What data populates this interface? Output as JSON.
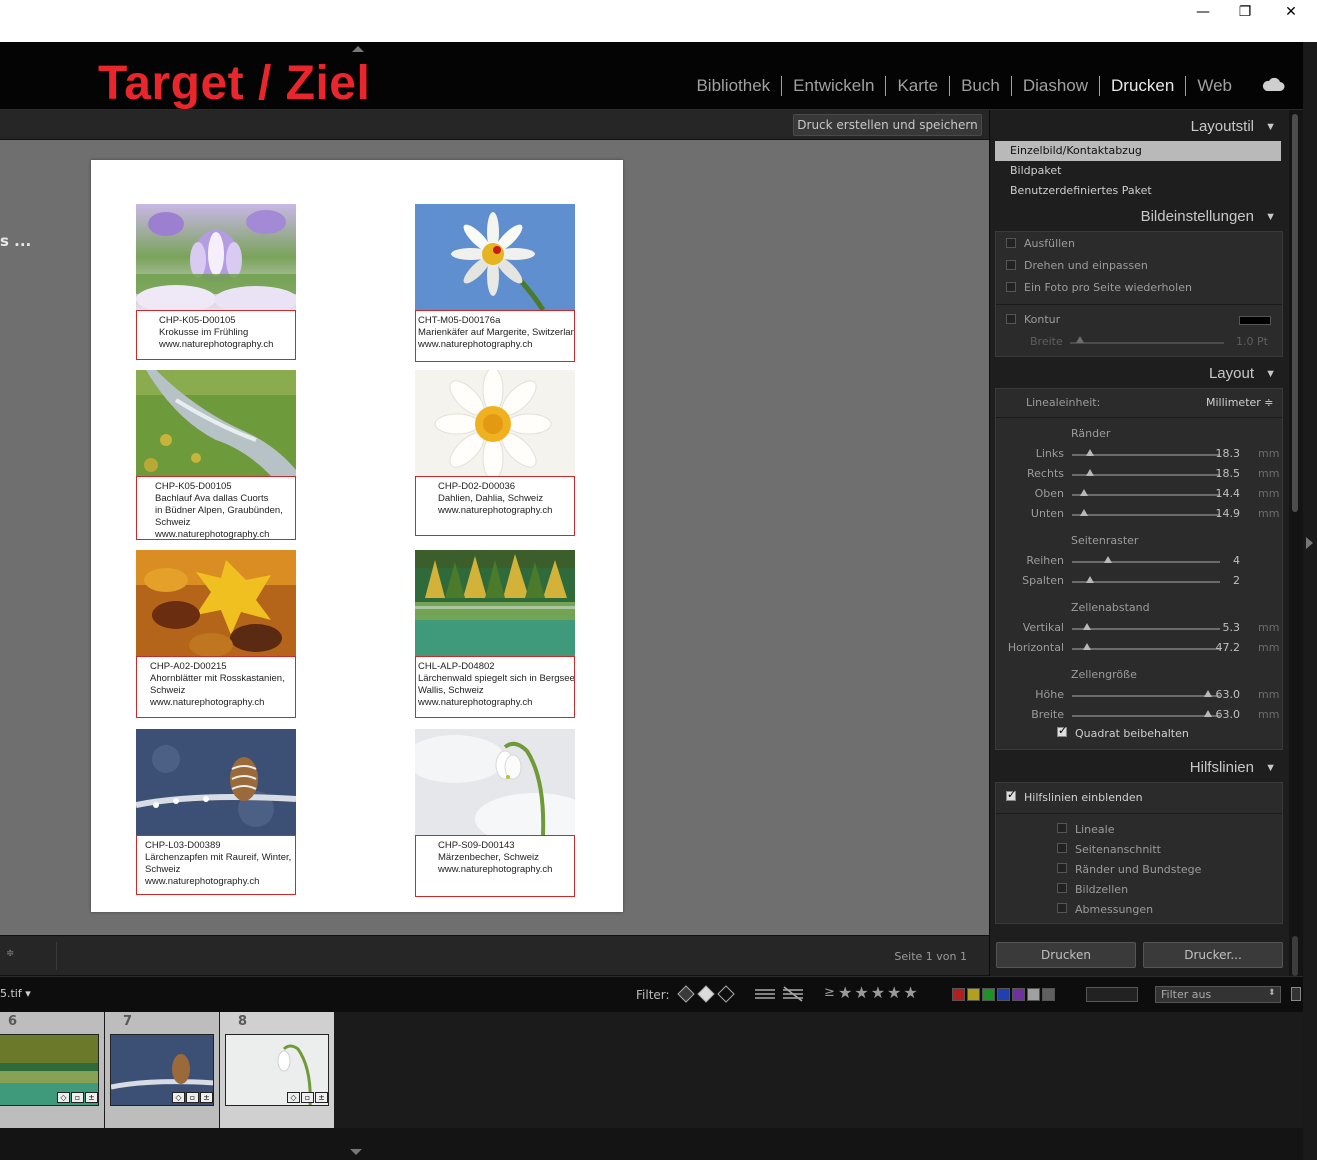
{
  "window": {
    "minimize": "—",
    "maximize": "❐",
    "close": "✕"
  },
  "header": {
    "brand": "Target / Ziel",
    "modules": [
      "Bibliothek",
      "Entwickeln",
      "Karte",
      "Buch",
      "Diashow",
      "Drucken",
      "Web"
    ],
    "active_module": "Drucken"
  },
  "toolbar": {
    "print_save": "Druck erstellen und speichern"
  },
  "workspace": {
    "left_fragment": "s ...",
    "page_status": "Seite 1 von 1",
    "cells": [
      {
        "lines": [
          "CHP-K05-D00105",
          "Krokusse im Frühling",
          "www.naturephotography.ch"
        ]
      },
      {
        "lines": [
          "CHT-M05-D00176a",
          "Marienkäfer auf Margerite, Switzerland",
          "www.naturephotography.ch"
        ]
      },
      {
        "lines": [
          "CHP-K05-D00105",
          "Bachlauf Ava dallas Cuorts",
          "in Büdner Alpen, Graubünden,",
          "Schweiz",
          "www.naturephotography.ch"
        ]
      },
      {
        "lines": [
          "CHP-D02-D00036",
          "Dahlien, Dahlia, Schweiz",
          "www.naturephotography.ch"
        ]
      },
      {
        "lines": [
          "CHP-A02-D00215",
          "Ahornblätter mit Rosskastanien,",
          "Schweiz",
          "www.naturephotography.ch"
        ]
      },
      {
        "lines": [
          "CHL-ALP-D04802",
          "Lärchenwald spiegelt sich in Bergsee,",
          "Wallis, Schweiz",
          "www.naturephotography.ch"
        ]
      },
      {
        "lines": [
          "CHP-L03-D00389",
          "Lärchenzapfen mit Raureif, Winter,",
          "Schweiz",
          "www.naturephotography.ch"
        ]
      },
      {
        "lines": [
          "CHP-S09-D00143",
          "Märzenbecher, Schweiz",
          "www.naturephotography.ch"
        ]
      }
    ]
  },
  "panel": {
    "layoutstil": {
      "title": "Layoutstil",
      "items": [
        "Einzelbild/Kontaktabzug",
        "Bildpaket",
        "Benutzerdefiniertes Paket"
      ],
      "selected": 0
    },
    "bildeinstellungen": {
      "title": "Bildeinstellungen",
      "options": [
        "Ausfüllen",
        "Drehen und einpassen",
        "Ein Foto pro Seite wiederholen"
      ],
      "kontur": "Kontur",
      "breite": "Breite",
      "breite_value": "1.0 Pt",
      "kontur_color": "#000000"
    },
    "layout": {
      "title": "Layout",
      "linealeinheit_label": "Linealeinheit:",
      "linealeinheit_value": "Millimeter ≑",
      "raender_title": "Ränder",
      "raender": [
        {
          "label": "Links",
          "value": "18.3",
          "unit": "mm",
          "pos": 0.12
        },
        {
          "label": "Rechts",
          "value": "18.5",
          "unit": "mm",
          "pos": 0.12
        },
        {
          "label": "Oben",
          "value": "14.4",
          "unit": "mm",
          "pos": 0.08
        },
        {
          "label": "Unten",
          "value": "14.9",
          "unit": "mm",
          "pos": 0.08
        }
      ],
      "seitenraster_title": "Seitenraster",
      "seitenraster": [
        {
          "label": "Reihen",
          "value": "4",
          "unit": "",
          "pos": 0.24
        },
        {
          "label": "Spalten",
          "value": "2",
          "unit": "",
          "pos": 0.12
        }
      ],
      "zellenabstand_title": "Zellenabstand",
      "zellenabstand": [
        {
          "label": "Vertikal",
          "value": "5.3",
          "unit": "mm",
          "pos": 0.1
        },
        {
          "label": "Horizontal",
          "value": "47.2",
          "unit": "mm",
          "pos": 0.1
        }
      ],
      "zellengroesse_title": "Zellengröße",
      "zellengroesse": [
        {
          "label": "Höhe",
          "value": "63.0",
          "unit": "mm",
          "pos": 0.92
        },
        {
          "label": "Breite",
          "value": "63.0",
          "unit": "mm",
          "pos": 0.92
        }
      ],
      "quadrat": "Quadrat beibehalten"
    },
    "hilfslinien": {
      "title": "Hilfslinien",
      "show": "Hilfslinien einblenden",
      "options": [
        "Lineale",
        "Seitenanschnitt",
        "Ränder und Bundstege",
        "Bildzellen",
        "Abmessungen"
      ]
    },
    "buttons": {
      "print": "Drucken",
      "printer": "Drucker..."
    }
  },
  "filterbar": {
    "filename": "5.tif ▾",
    "filter_label": "Filter:",
    "filter_value": "Filter aus",
    "stars": "★★★★★",
    "color_labels": [
      "#b02020",
      "#b0a020",
      "#20902a",
      "#2040b0",
      "#7030a0",
      "#a0a0a0",
      "#606060"
    ]
  },
  "filmstrip": [
    {
      "num": "6"
    },
    {
      "num": "7"
    },
    {
      "num": "8"
    }
  ]
}
